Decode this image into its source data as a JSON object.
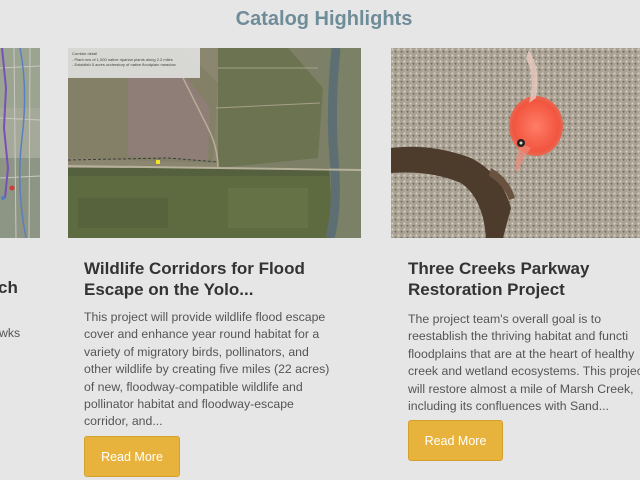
{
  "section": {
    "title": "Catalog Highlights"
  },
  "cards": [
    {
      "title_fragment": "ch",
      "desc_fragment": "wks"
    },
    {
      "title": "Wildlife Corridors for Flood\nEscape on the Yolo...",
      "description": "This project will provide wildlife flood escape\ncover and enhance year round habitat for a\nvariety of migratory birds, pollinators, and\nother wildlife by creating five miles (22 acres)\nof new, floodway-compatible wildlife and\npollinator habitat and floodway-escape\ncorridor, and...",
      "button_label": "Read More",
      "map_legend": "Corridor detail\n- Plant row of 1,000 native riparian plants along 2.2 miles\n- Establish 5 acres understory of native floodplain meadow"
    },
    {
      "title": "Three Creeks Parkway\nRestoration Project",
      "description": "The project team's overall goal is to\nreestablish the thriving habitat and functi\nfloodplains that are at the heart of healthy\ncreek and wetland ecosystems. This projec\nwill restore almost a mile of Marsh Creek,\nincluding its confluences with Sand...",
      "button_label": "Read More"
    }
  ],
  "colors": {
    "background": "#e6e6e6",
    "title": "#6f8c99",
    "button": "#e8b33c"
  }
}
